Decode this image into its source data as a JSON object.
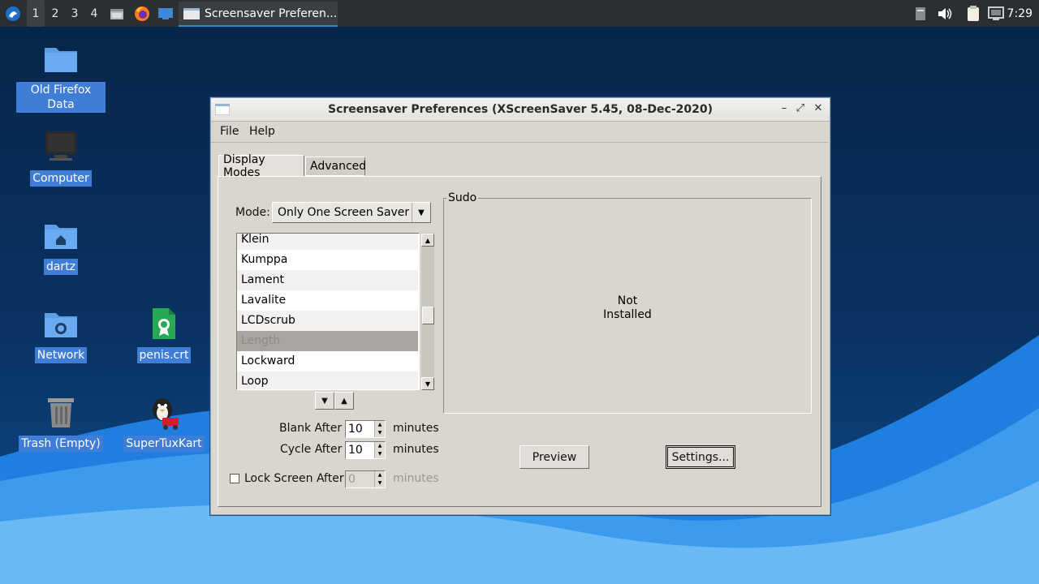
{
  "taskbar": {
    "workspaces": [
      "1",
      "2",
      "3",
      "4"
    ],
    "active_workspace": "1",
    "task_title": "Screensaver Preferen...",
    "clock": "7:29"
  },
  "desktop": {
    "icons": [
      {
        "label": "Old Firefox Data",
        "icon": "folder-icon"
      },
      {
        "label": "Computer",
        "icon": "computer-icon"
      },
      {
        "label": "dartz",
        "icon": "home-folder-icon"
      },
      {
        "label": "Network",
        "icon": "network-folder-icon"
      },
      {
        "label": "penis.crt",
        "icon": "certificate-file-icon"
      },
      {
        "label": "Trash (Empty)",
        "icon": "trash-icon"
      },
      {
        "label": "SuperTuxKart",
        "icon": "supertuxkart-icon"
      }
    ]
  },
  "dialog": {
    "title": "Screensaver Preferences  (XScreenSaver 5.45, 08-Dec-2020)",
    "menu": {
      "file": "File",
      "help": "Help"
    },
    "tabs": {
      "display_modes": "Display Modes",
      "advanced": "Advanced"
    },
    "mode_label": "Mode:",
    "mode_value": "Only One Screen Saver",
    "list_items": [
      "Klein",
      "Kumppa",
      "Lament",
      "Lavalite",
      "LCDscrub",
      "Length",
      "Lockward",
      "Loop"
    ],
    "selected_item": "Length",
    "blank_after": {
      "label": "Blank After",
      "value": "10",
      "unit": "minutes"
    },
    "cycle_after": {
      "label": "Cycle After",
      "value": "10",
      "unit": "minutes"
    },
    "lock_after": {
      "label": "Lock Screen After",
      "value": "0",
      "unit": "minutes",
      "checked": false
    },
    "preview_frame": {
      "title": "Sudo",
      "line1": "Not",
      "line2": "Installed"
    },
    "preview_button": "Preview",
    "settings_button": "Settings..."
  },
  "colors": {
    "accent": "#2f87d8",
    "selection": "#3f7dd6"
  }
}
